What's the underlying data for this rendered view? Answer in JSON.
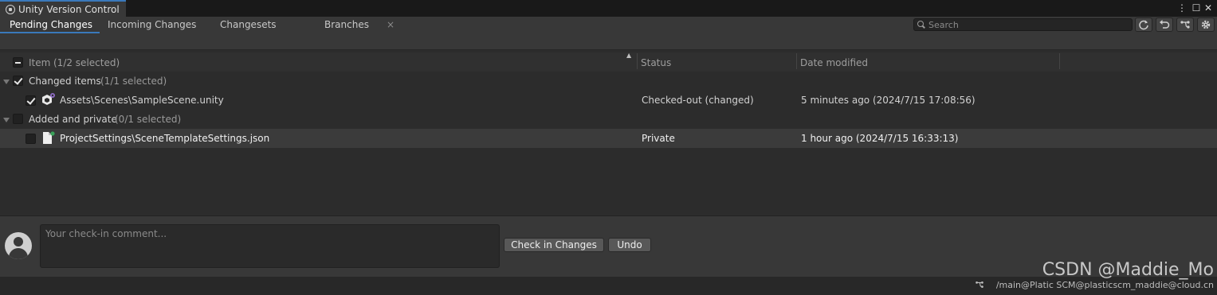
{
  "window": {
    "title": "Unity Version Control",
    "controls": [
      "⋮",
      "☐",
      "✕"
    ]
  },
  "tabs": [
    {
      "label": "Pending Changes",
      "active": true
    },
    {
      "label": "Incoming Changes",
      "active": false
    },
    {
      "label": "Changesets",
      "active": false
    },
    {
      "label": "Branches",
      "active": false,
      "close": "×"
    }
  ],
  "search": {
    "placeholder": "Search",
    "value": ""
  },
  "toolbar_icons": [
    "refresh-icon",
    "undo-icon",
    "branch-icon",
    "gear-icon"
  ],
  "table": {
    "headers": {
      "item": "Item",
      "item_count": "(1/2 selected)",
      "status": "Status",
      "date": "Date modified"
    },
    "groups": [
      {
        "label": "Changed items",
        "count": "(1/1 selected)",
        "checked": true,
        "items": [
          {
            "path": "Assets\\Scenes\\SampleScene.unity",
            "status": "Checked-out (changed)",
            "date": "5 minutes ago (2024/7/15 17:08:56)",
            "checked": true
          }
        ]
      },
      {
        "label": "Added and private",
        "count": "(0/1 selected)",
        "checked": false,
        "items": [
          {
            "path": "ProjectSettings\\SceneTemplateSettings.json",
            "status": "Private",
            "date": "1 hour ago (2024/7/15 16:33:13)",
            "checked": false
          }
        ]
      }
    ]
  },
  "comment": {
    "placeholder": "Your check-in comment..."
  },
  "buttons": {
    "checkin": "Check in Changes",
    "undo": "Undo"
  },
  "statusbar": {
    "text": "/main@Platic SCM@plasticscm_maddie@cloud.cn"
  },
  "watermark": "CSDN @Maddie_Mo",
  "colors": {
    "accent": "#3a79bb",
    "background": "#383838",
    "list_bg": "#2c2c2c",
    "selected_row": "#3b3b3b"
  }
}
